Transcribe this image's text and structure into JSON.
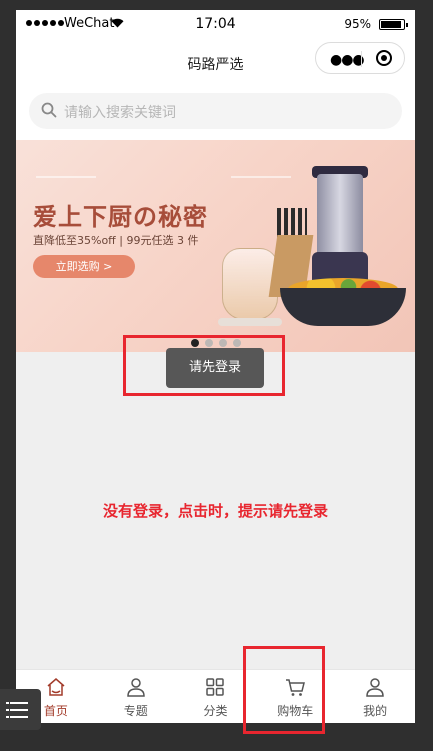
{
  "status_bar": {
    "carrier": "WeChat",
    "time": "17:04",
    "battery": "95%"
  },
  "nav": {
    "title": "码路严选"
  },
  "search": {
    "placeholder": "请输入搜索关键词"
  },
  "banner": {
    "title": "爱上下厨の秘密",
    "subtitle": "直降低至35%off | 99元任选 3 件",
    "button": "立即选购 >",
    "slides": 4,
    "active_slide": 1
  },
  "toast": {
    "text": "请先登录"
  },
  "annotation": {
    "text": "没有登录，点击时，提示请先登录"
  },
  "tab_bar": {
    "items": [
      {
        "label": "首页",
        "icon": "home-icon",
        "active": true
      },
      {
        "label": "专题",
        "icon": "person-icon",
        "active": false
      },
      {
        "label": "分类",
        "icon": "grid-icon",
        "active": false
      },
      {
        "label": "购物车",
        "icon": "cart-icon",
        "active": false
      },
      {
        "label": "我的",
        "icon": "user-icon",
        "active": false
      }
    ]
  },
  "colors": {
    "accent": "#a23b2a",
    "annotation": "#e8262f",
    "toast_bg": "#575757"
  }
}
